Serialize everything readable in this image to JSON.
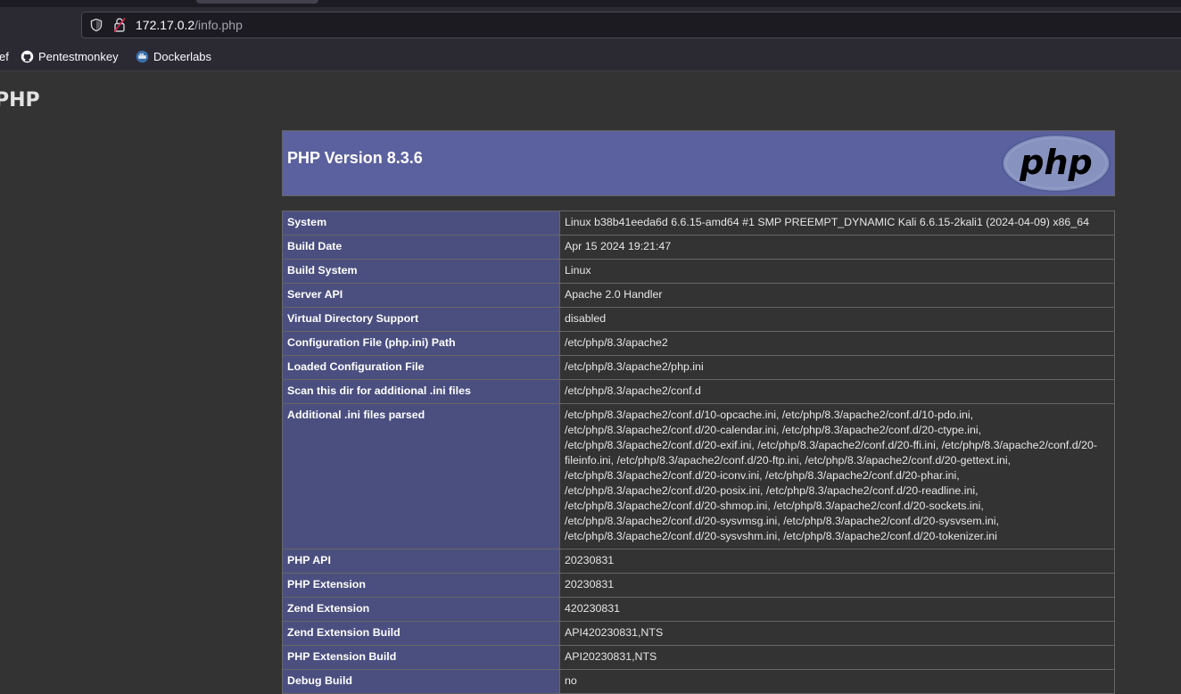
{
  "browser": {
    "url_host": "172.17.0.2",
    "url_path": "/info.php",
    "bookmarks": [
      {
        "label": "ef",
        "icon": "folder-icon"
      },
      {
        "label": "Pentestmonkey",
        "icon": "github-icon"
      },
      {
        "label": "Dockerlabs",
        "icon": "dockerlabs-icon"
      }
    ]
  },
  "page": {
    "heading": "PHP",
    "version_title": "PHP Version 8.3.6",
    "logo_text": "php"
  },
  "info_table": [
    {
      "key": "System",
      "value": "Linux b38b41eeda6d 6.6.15-amd64 #1 SMP PREEMPT_DYNAMIC Kali 6.6.15-2kali1 (2024-04-09) x86_64"
    },
    {
      "key": "Build Date",
      "value": "Apr 15 2024 19:21:47"
    },
    {
      "key": "Build System",
      "value": "Linux"
    },
    {
      "key": "Server API",
      "value": "Apache 2.0 Handler"
    },
    {
      "key": "Virtual Directory Support",
      "value": "disabled"
    },
    {
      "key": "Configuration File (php.ini) Path",
      "value": "/etc/php/8.3/apache2"
    },
    {
      "key": "Loaded Configuration File",
      "value": "/etc/php/8.3/apache2/php.ini"
    },
    {
      "key": "Scan this dir for additional .ini files",
      "value": "/etc/php/8.3/apache2/conf.d"
    },
    {
      "key": "Additional .ini files parsed",
      "value": "/etc/php/8.3/apache2/conf.d/10-opcache.ini, /etc/php/8.3/apache2/conf.d/10-pdo.ini, /etc/php/8.3/apache2/conf.d/20-calendar.ini, /etc/php/8.3/apache2/conf.d/20-ctype.ini, /etc/php/8.3/apache2/conf.d/20-exif.ini, /etc/php/8.3/apache2/conf.d/20-ffi.ini, /etc/php/8.3/apache2/conf.d/20-fileinfo.ini, /etc/php/8.3/apache2/conf.d/20-ftp.ini, /etc/php/8.3/apache2/conf.d/20-gettext.ini, /etc/php/8.3/apache2/conf.d/20-iconv.ini, /etc/php/8.3/apache2/conf.d/20-phar.ini, /etc/php/8.3/apache2/conf.d/20-posix.ini, /etc/php/8.3/apache2/conf.d/20-readline.ini, /etc/php/8.3/apache2/conf.d/20-shmop.ini, /etc/php/8.3/apache2/conf.d/20-sockets.ini, /etc/php/8.3/apache2/conf.d/20-sysvmsg.ini, /etc/php/8.3/apache2/conf.d/20-sysvsem.ini, /etc/php/8.3/apache2/conf.d/20-sysvshm.ini, /etc/php/8.3/apache2/conf.d/20-tokenizer.ini"
    },
    {
      "key": "PHP API",
      "value": "20230831"
    },
    {
      "key": "PHP Extension",
      "value": "20230831"
    },
    {
      "key": "Zend Extension",
      "value": "420230831"
    },
    {
      "key": "Zend Extension Build",
      "value": "API420230831,NTS"
    },
    {
      "key": "PHP Extension Build",
      "value": "API20230831,NTS"
    },
    {
      "key": "Debug Build",
      "value": "no"
    }
  ],
  "colors": {
    "page_bg": "#333333",
    "header_bg": "#5b609e",
    "key_cell_bg": "#4b4f7f",
    "border": "#666666"
  }
}
